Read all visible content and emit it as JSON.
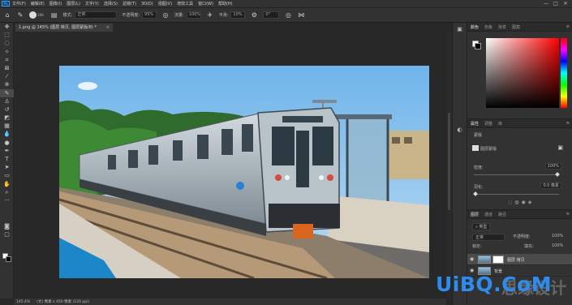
{
  "menubar": {
    "logo": "Ps",
    "items": [
      "文件(F)",
      "编辑(E)",
      "图像(I)",
      "图层(L)",
      "文字(Y)",
      "选择(S)",
      "滤镜(T)",
      "3D(D)",
      "视图(V)",
      "增效工具",
      "窗口(W)",
      "帮助(H)"
    ],
    "win": [
      "—",
      "□",
      "✕"
    ]
  },
  "options": {
    "brush_size": "288",
    "mode_label": "模式:",
    "mode_value": "正常",
    "opacity_label": "不透明度:",
    "opacity_value": "95%",
    "flow_label": "流量:",
    "flow_value": "100%",
    "smooth_label": "平滑:",
    "smooth_value": "10%",
    "angle_value": "0°"
  },
  "document": {
    "tab_title": "1.png @ 145% (图层 拷贝, 图层蒙版/8) *",
    "tab_close": "×"
  },
  "status": {
    "zoom": "145.4%",
    "doc_info": "(文) 像素 x 450 像素 (120 ppi)"
  },
  "color_panel": {
    "tabs": [
      "颜色",
      "色板",
      "渐变",
      "图案"
    ]
  },
  "properties_panel": {
    "tabs": [
      "属性",
      "调整",
      "库"
    ],
    "type_label": "蒙版",
    "layer_mask_label": "图层蒙版",
    "density_label": "密度:",
    "density_value": "100%",
    "feather_label": "羽化:",
    "feather_value": "0.0 像素"
  },
  "layers_panel": {
    "tabs": [
      "图层",
      "通道",
      "路径"
    ],
    "kind_label": "类型",
    "blend_mode": "正常",
    "opacity_label": "不透明度:",
    "opacity_value": "100%",
    "lock_label": "锁定:",
    "fill_label": "填充:",
    "fill_value": "100%",
    "layers": [
      {
        "name": "图层 拷贝",
        "selected": true
      },
      {
        "name": "背景",
        "selected": false
      }
    ]
  },
  "watermark": {
    "brand": "UiBQ.CoM",
    "text": "思缘设计"
  },
  "colors": {
    "accent": "#31a8ff",
    "watermark": "#2d8cf0",
    "sky": "#87c1ec",
    "train": "#b8c2c9"
  }
}
